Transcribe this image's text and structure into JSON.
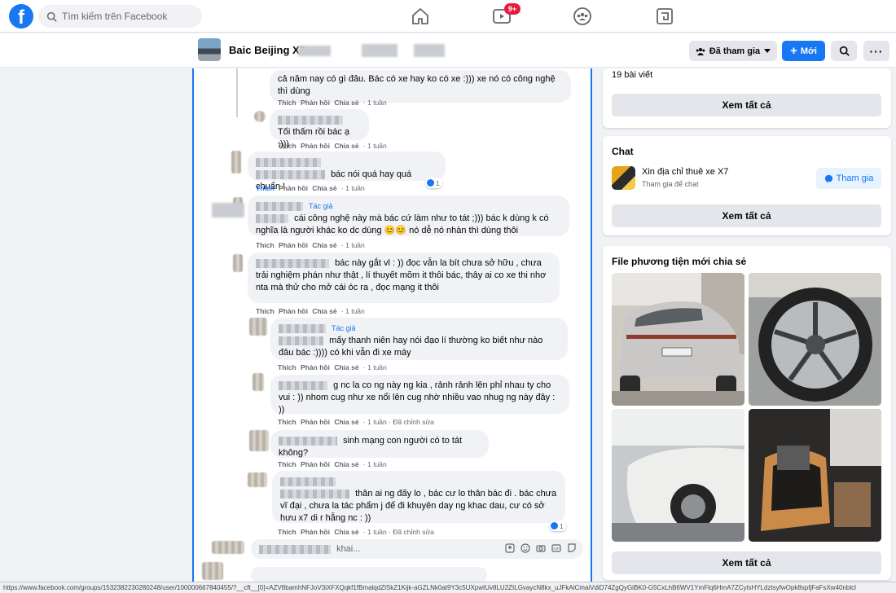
{
  "nav": {
    "logo": "f",
    "search_placeholder": "Tìm kiếm trên Facebook",
    "watch_badge": "9+"
  },
  "group": {
    "name": "Baic Beijing X7",
    "joined_label": "Đã tham gia",
    "new_label": "Mới"
  },
  "comments": [
    {
      "text": "cả năm nay có gì đâu. Bác có xe hay ko có xe :))) xe nó có công nghệ thì dùng",
      "like": "Thích",
      "reply": "Phản hồi",
      "share": "Chia sẻ",
      "time": "1 tuần"
    },
    {
      "text": "Tối thấm rồi bác ạ :)))",
      "like": "Thích",
      "reply": "Phản hồi",
      "share": "Chia sẻ",
      "time": "1 tuần"
    },
    {
      "text": "bác nói quá hay quá chuẩn !",
      "like": "Thích",
      "reply": "Phản hồi",
      "share": "Chia sẻ",
      "time": "1 tuần",
      "reactions": "1"
    },
    {
      "tag": "Tác giả",
      "text": "cái công nghệ này mà bác cứ làm như to tát ;))) bác k dùng k có nghĩa là người khác ko dc dùng 😊😊 nó dễ nó nhàn thì dùng thôi",
      "like": "Thích",
      "reply": "Phản hồi",
      "share": "Chia sẻ",
      "time": "1 tuần"
    },
    {
      "text": "bác này gắt vl : )) đọc vẫn la bít chưa sở hữu , chưa trải nghiệm phán như thật , lí thuyết mõm it thôi bác, thây ai co xe thi nhơ nta mà thử cho mở cái óc ra , đọc mạng it thôi",
      "like": "Thích",
      "reply": "Phản hồi",
      "share": "Chia sẻ",
      "time": "1 tuần"
    },
    {
      "tag": "Tác giả",
      "text": "mấy thanh niên hay nói đạo lí thường ko biết như nào đâu bác :)))) có khi vẫn đi xe máy",
      "like": "Thích",
      "reply": "Phản hồi",
      "share": "Chia sẻ",
      "time": "1 tuần"
    },
    {
      "text": "g nc la co ng này ng kia , rảnh rảnh lên phỉ nhau ty cho vui : )) nhom cug như xe nổi lên cug nhờ nhiều vao nhug ng này đây : ))",
      "like": "Thích",
      "reply": "Phản hồi",
      "share": "Chia sẻ",
      "time": "1 tuần",
      "edited": "Đã chỉnh sửa"
    },
    {
      "text": "sinh mạng con người có to tát không?",
      "like": "Thích",
      "reply": "Phản hồi",
      "share": "Chia sẻ",
      "time": "1 tuần"
    },
    {
      "text": "thân ai ng đấy lo , bác cư lo thân bác đi . bác chưa vĩ đại , chưa la tác phẩm j để đi khuyên day ng khac dau, cư có sở hưu x7 di r hẵng nc : ))",
      "like": "Thích",
      "reply": "Phản hồi",
      "share": "Chia sẻ",
      "time": "1 tuần",
      "edited": "Đã chỉnh sửa",
      "reactions": "1"
    }
  ],
  "reply_input": {
    "placeholder": "khai..."
  },
  "right": {
    "posts_count": "19 bài viết",
    "see_all": "Xem tất cả",
    "chat_title": "Chat",
    "chat_name": "Xin địa chỉ thuê xe X7",
    "chat_sub": "Tham gia để chat",
    "chat_join": "Tham gia",
    "media_title": "File phương tiện mới chia sẻ"
  },
  "status_url": "https://www.facebook.com/groups/1532382230280248/user/100000667840455/?__cft__[0]=AZV8bamhNFJoV3iXFXQqkf1fBmalqdZlSkZ1Kijk-aGZLNk0at9Y3c5UXpwtUv8LU2ZILGvaycN8kx_uJFkAiCmaiVdiD74ZgQyGiBK0-G5CxLhB6WV1YmFlq6HmA7ZCylsHYLdztsyfwOpk8spfjFaFsXw40nblcl",
  "colors": {
    "brand": "#1877f2",
    "badge": "#e41e3f",
    "bg": "#f0f2f5"
  }
}
